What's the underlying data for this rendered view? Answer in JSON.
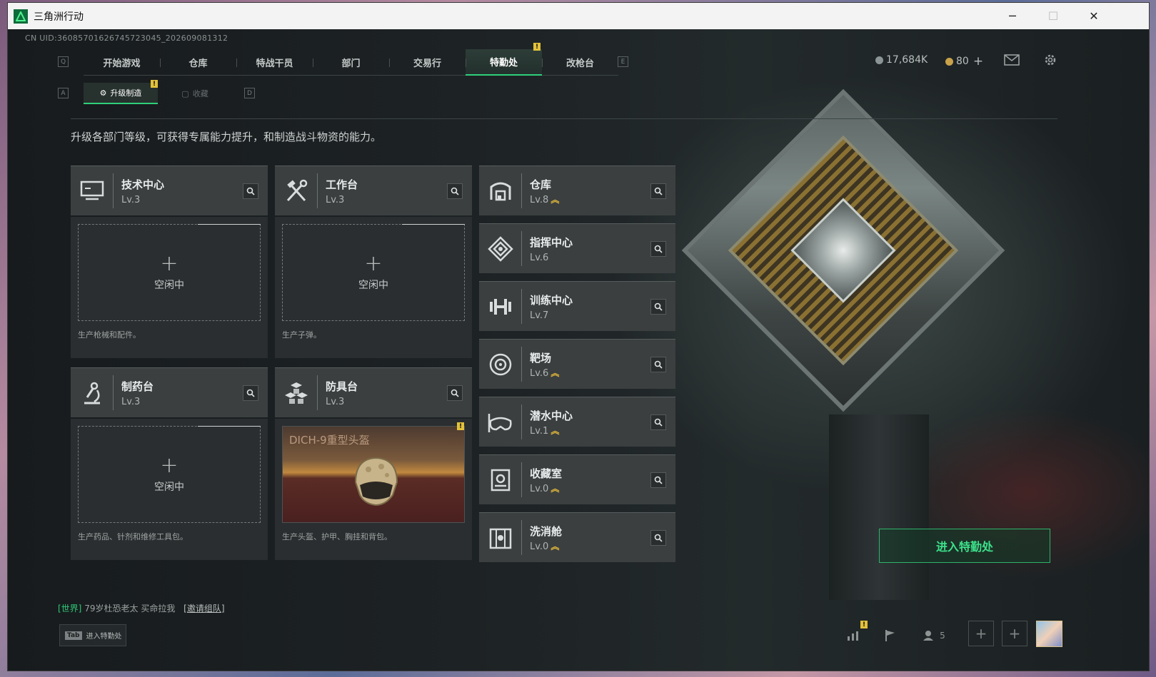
{
  "window": {
    "title": "三角洲行动",
    "minimize": "─",
    "maximize": "☐",
    "close": "✕"
  },
  "uid": "CN UID:360857016267457230​45_202609081312",
  "keyhints": {
    "q": "Q",
    "e": "E",
    "a": "A",
    "d": "D"
  },
  "topnav": {
    "tabs": [
      {
        "label": "开始游戏"
      },
      {
        "label": "仓库"
      },
      {
        "label": "特战干员"
      },
      {
        "label": "部门"
      },
      {
        "label": "交易行"
      },
      {
        "label": "特勤处"
      },
      {
        "label": "改枪台"
      }
    ],
    "active": "特勤处",
    "badge": "!"
  },
  "currency": {
    "primary": "17,684K",
    "secondary": "80",
    "add": "+"
  },
  "subnav": {
    "tabs": [
      {
        "label": "升级制造"
      },
      {
        "label": "收藏"
      }
    ],
    "badge": "!"
  },
  "description": "升级各部门等级，可获得专属能力提升，和制造战斗物资的能力。",
  "stations": [
    {
      "name": "技术中心",
      "level": "Lv.3",
      "icon": "monitor-icon",
      "slot_status": "空闲中",
      "slot_desc": "生产枪械和配件。"
    },
    {
      "name": "工作台",
      "level": "Lv.3",
      "icon": "tools-icon",
      "slot_status": "空闲中",
      "slot_desc": "生产子弹。"
    },
    {
      "name": "制药台",
      "level": "Lv.3",
      "icon": "microscope-icon",
      "slot_status": "空闲中",
      "slot_desc": "生产药品、针剂和维修工具包。"
    },
    {
      "name": "防具台",
      "level": "Lv.3",
      "icon": "armor-blocks-icon",
      "slot_item": "DICH-9重型头盔",
      "slot_desc": "生产头盔、护甲、胸挂和背包。"
    }
  ],
  "departments": [
    {
      "name": "仓库",
      "level": "Lv.8",
      "upgradable": true,
      "icon": "warehouse-icon"
    },
    {
      "name": "指挥中心",
      "level": "Lv.6",
      "upgradable": false,
      "icon": "command-icon"
    },
    {
      "name": "训练中心",
      "level": "Lv.7",
      "upgradable": false,
      "icon": "dumbbell-icon"
    },
    {
      "name": "靶场",
      "level": "Lv.6",
      "upgradable": true,
      "icon": "target-icon"
    },
    {
      "name": "潜水中心",
      "level": "Lv.1",
      "upgradable": true,
      "icon": "diving-mask-icon"
    },
    {
      "name": "收藏室",
      "level": "Lv.0",
      "upgradable": true,
      "icon": "collection-icon"
    },
    {
      "name": "洗消舱",
      "level": "Lv.0",
      "upgradable": true,
      "icon": "decon-icon"
    }
  ],
  "upgrade_arrow": "︽",
  "enter_button": "进入特勤处",
  "chat": {
    "channel": "[世界]",
    "user": "79岁杜恐老太",
    "message": "买命拉我",
    "action": "[邀请组队]"
  },
  "tab_hint": {
    "key": "Tab",
    "label": "进入特勤处"
  },
  "bottom_bar": {
    "friends_count": "5",
    "add": "+"
  },
  "colors": {
    "accent": "#2fd07a",
    "badge": "#e3c23a",
    "upgrade": "#e3b93a"
  }
}
